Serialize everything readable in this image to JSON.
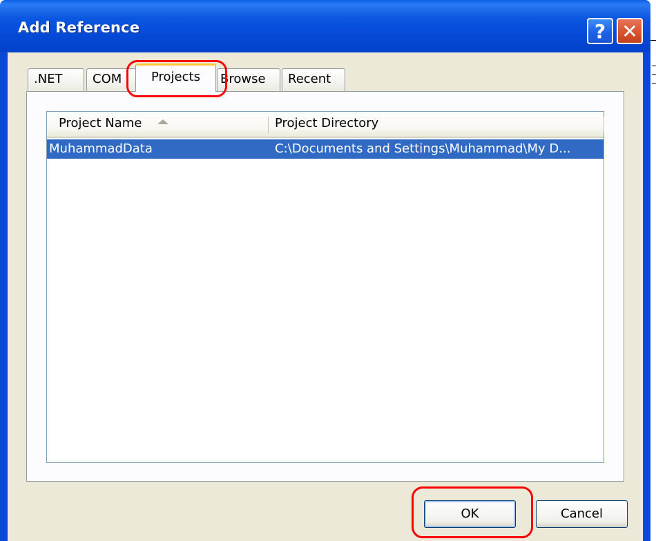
{
  "window": {
    "title": "Add Reference",
    "help_symbol": "?",
    "close_symbol": "✕"
  },
  "tabs": [
    {
      "label": ".NET",
      "active": false
    },
    {
      "label": "COM",
      "active": false
    },
    {
      "label": "Projects",
      "active": true
    },
    {
      "label": "Browse",
      "active": false
    },
    {
      "label": "Recent",
      "active": false
    }
  ],
  "list": {
    "columns": [
      "Project Name",
      "Project Directory"
    ],
    "sort_icon": "sort-ascending-icon",
    "rows": [
      {
        "name": "MuhammadData",
        "directory": "C:\\Documents and Settings\\Muhammad\\My D...",
        "selected": true
      }
    ]
  },
  "buttons": {
    "ok": "OK",
    "cancel": "Cancel"
  },
  "colors": {
    "titlebar": "#0a49d8",
    "selection": "#316ac5",
    "dialog_bg": "#ece9d8",
    "highlight_ring": "#ff0000"
  }
}
